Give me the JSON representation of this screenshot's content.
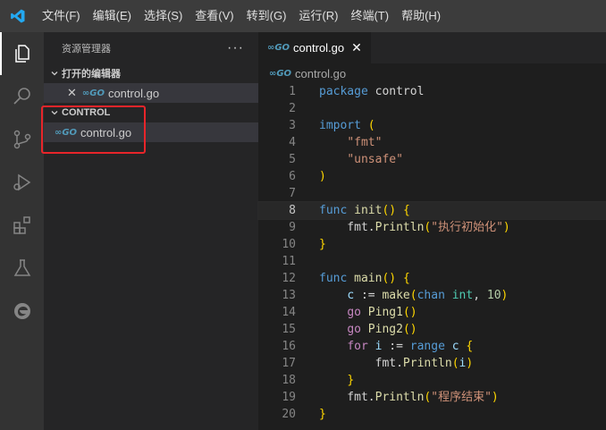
{
  "menu": [
    "文件(F)",
    "编辑(E)",
    "选择(S)",
    "查看(V)",
    "转到(G)",
    "运行(R)",
    "终端(T)",
    "帮助(H)"
  ],
  "sidebar": {
    "title": "资源管理器",
    "more": "···",
    "open_editors_label": "打开的编辑器",
    "open_editor_file": "control.go",
    "folder_label": "CONTROL",
    "folder_file": "control.go"
  },
  "editor": {
    "tab_label": "control.go",
    "tab_close": "✕",
    "breadcrumb": "control.go",
    "current_line": 8,
    "lines": [
      "package control",
      "",
      "import (",
      "    \"fmt\"",
      "    \"unsafe\"",
      ")",
      "",
      "func init() {",
      "    fmt.Println(\"执行初始化\")",
      "}",
      "",
      "func main() {",
      "    c := make(chan int, 10)",
      "    go Ping1()",
      "    go Ping2()",
      "    for i := range c {",
      "        fmt.Println(i)",
      "    }",
      "    fmt.Println(\"程序结束\")",
      "}"
    ]
  },
  "colors": {
    "accent": "#007acc",
    "highlight_box": "#e8252a",
    "go_icon": "#519aba"
  }
}
